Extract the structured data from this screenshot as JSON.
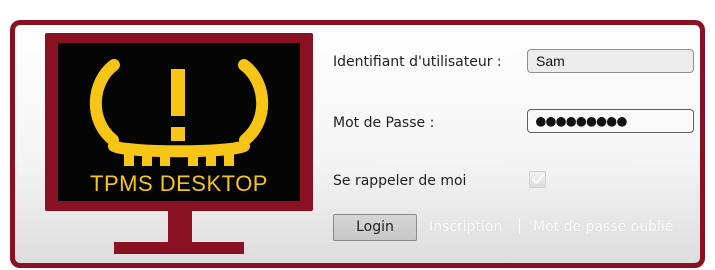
{
  "form": {
    "username_label": "Identifiant d'utilisateur :",
    "username_value": "Sam",
    "password_label": "Mot de Passe :",
    "password_masked": "●●●●●●●●●",
    "remember_label": "Se rappeler de moi",
    "remember_checked": true,
    "login_label": "Login",
    "register_label": "Inscription",
    "forgot_label": "Mot de passe oublié"
  },
  "branding": {
    "logo_text": "TPMS DESKTOP",
    "monitor_color": "#8a1024",
    "logo_color": "#f6c515",
    "screen_color": "#050505"
  },
  "icons": {
    "monitor": "monitor-icon",
    "warning": "tpms-warning-icon",
    "checkbox": "checkbox-icon"
  }
}
